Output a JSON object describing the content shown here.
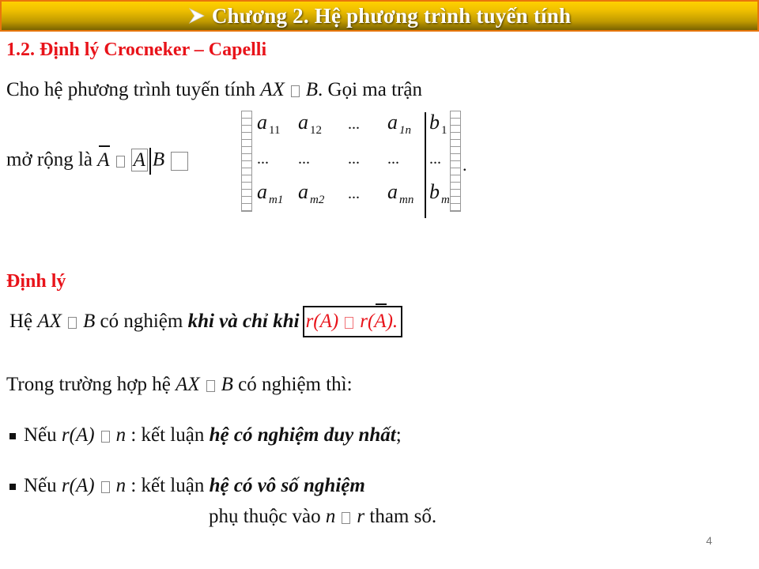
{
  "header": {
    "icon": "arrow-bullet-icon",
    "title": "Chương 2. Hệ phương trình tuyến tính"
  },
  "section": {
    "title": "1.2. Định lý Crocneker – Capelli"
  },
  "intro": {
    "line1_prefix": "Cho hệ phương trình tuyến tính ",
    "line1_eq_lhs": "AX",
    "line1_eq_rhs": "B",
    "line1_suffix": ". Gọi ma trận",
    "line2_prefix": "mở rộng là ",
    "line2_abar": "A",
    "line2_a": "A",
    "line2_b": "B",
    "line2_suffix": "."
  },
  "matrix": {
    "rows": [
      [
        {
          "base": "a",
          "sub": "11"
        },
        {
          "base": "a",
          "sub": "12"
        },
        {
          "base": "...",
          "sub": ""
        },
        {
          "base": "a",
          "sub": "1n"
        },
        {
          "base": "b",
          "sub": "1"
        }
      ],
      [
        {
          "base": "...",
          "sub": ""
        },
        {
          "base": "...",
          "sub": ""
        },
        {
          "base": "...",
          "sub": ""
        },
        {
          "base": "...",
          "sub": ""
        },
        {
          "base": "...",
          "sub": ""
        }
      ],
      [
        {
          "base": "a",
          "sub": "m1"
        },
        {
          "base": "a",
          "sub": "m2"
        },
        {
          "base": "...",
          "sub": ""
        },
        {
          "base": "a",
          "sub": "mn"
        },
        {
          "base": "b",
          "sub": "m"
        }
      ]
    ]
  },
  "theorem": {
    "label": "Định lý",
    "prefix": "Hệ ",
    "eq_lhs": "AX",
    "eq_rhs": "B",
    "middle": " có nghiệm ",
    "emphasis": "khi và chỉ khi",
    "boxed_lhs": "r(A)",
    "boxed_rhs_r": "r(",
    "boxed_rhs_a": "A",
    "boxed_rhs_end": ")."
  },
  "case_intro": {
    "prefix": "Trong trường hợp hệ ",
    "eq_lhs": "AX",
    "eq_rhs": "B",
    "suffix": " có nghiệm thì:"
  },
  "bullets": [
    {
      "prefix": "Nếu ",
      "cond_lhs": "r(A)",
      "cond_rhs": "n",
      "middle": " : kết luận ",
      "conclusion": "hệ có nghiệm duy nhất",
      "suffix": ";"
    },
    {
      "prefix": "Nếu ",
      "cond_lhs": "r(A)",
      "cond_rhs": "n",
      "middle": " : kết luận ",
      "conclusion": "hệ có vô số nghiệm",
      "suffix": "",
      "continuation_prefix": "phụ thuộc vào ",
      "continuation_n": "n",
      "continuation_r": "r",
      "continuation_suffix": " tham số."
    }
  ],
  "footer": {
    "page_number": "4"
  }
}
